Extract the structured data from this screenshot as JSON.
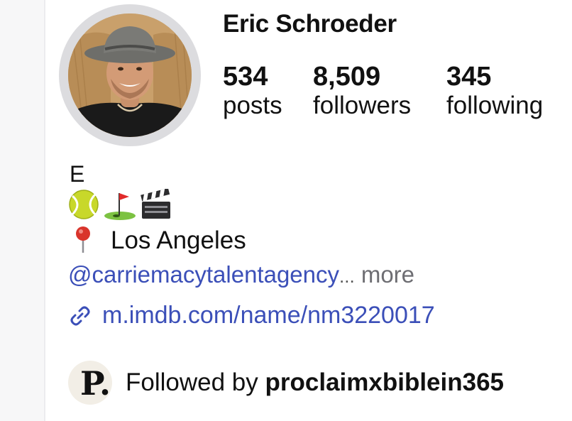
{
  "profile": {
    "name": "Eric Schroeder",
    "avatar_desc": "profile photo",
    "stats": {
      "posts": {
        "value": "534",
        "label": "posts"
      },
      "followers": {
        "value": "8,509",
        "label": "followers"
      },
      "following": {
        "value": "345",
        "label": "following"
      }
    }
  },
  "bio": {
    "initial": "E",
    "emojis": [
      "tennis-ball",
      "golf-flag",
      "clapperboard"
    ],
    "location_icon": "round-pushpin",
    "location": "Los Angeles",
    "mention": "@carriemacytalentagency",
    "ellipsis": "...",
    "more": "more",
    "link_icon": "link-icon",
    "link": "m.imdb.com/name/nm3220017"
  },
  "followed_by": {
    "prefix": "Followed by",
    "account": "proclaimxbiblein365",
    "avatar_letter": "P."
  },
  "colors": {
    "link_blue": "#3b4fb8",
    "muted": "#6e6e73",
    "ring": "#dcdcdf"
  }
}
